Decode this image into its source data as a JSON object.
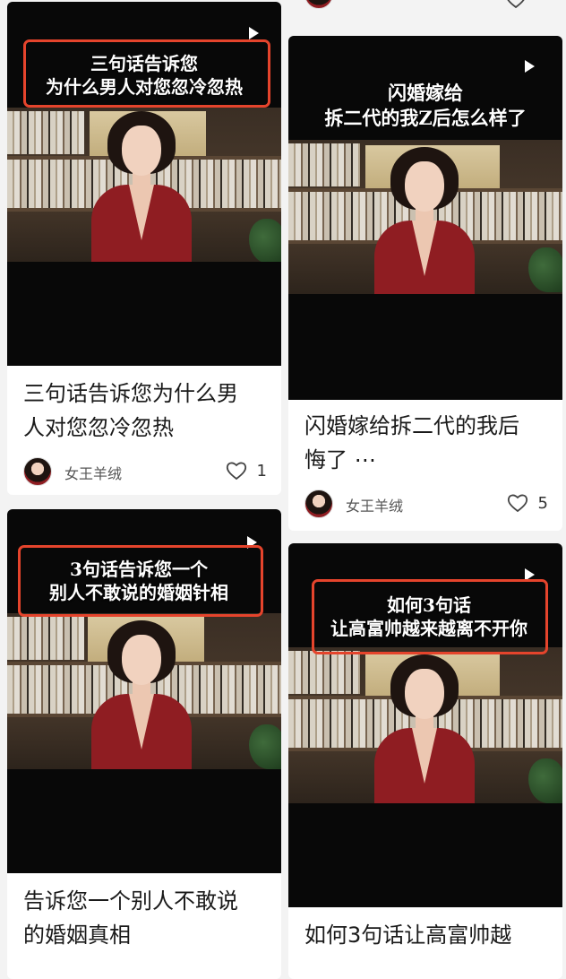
{
  "feed": {
    "cards": [
      {
        "overlay_text": "三句话告诉您\n为什么男人对您忽冷忽热",
        "title": "三句话告诉您为什么男\n人对您忽冷忽热",
        "author": "女王羊绒",
        "likes": "1",
        "icons": [
          "play-icon",
          "heart-icon"
        ]
      },
      {
        "overlay_text": "闪婚嫁给\n拆二代的我Z后怎么样了",
        "title": "闪婚嫁给拆二代的我后\n悔了 ⋯",
        "author": "女王羊绒",
        "likes": "5",
        "icons": [
          "play-icon",
          "heart-icon"
        ]
      },
      {
        "overlay_text": "3句话告诉您一个\n别人不敢说的婚姻针相",
        "title": "告诉您一个别人不敢说\n的婚姻真相",
        "author": "",
        "likes": "",
        "icons": [
          "play-icon"
        ]
      },
      {
        "overlay_text": "如何3句话\n让高富帅越来越离不开你",
        "title": "如何3句话让高富帅越",
        "author": "",
        "likes": "",
        "icons": [
          "play-icon"
        ]
      }
    ],
    "colors": {
      "highlight_border": "#e5442c",
      "card_bg": "#ffffff",
      "page_bg": "#f3f3f3",
      "video_bg": "#080808",
      "blazer": "#8f1d22"
    }
  }
}
